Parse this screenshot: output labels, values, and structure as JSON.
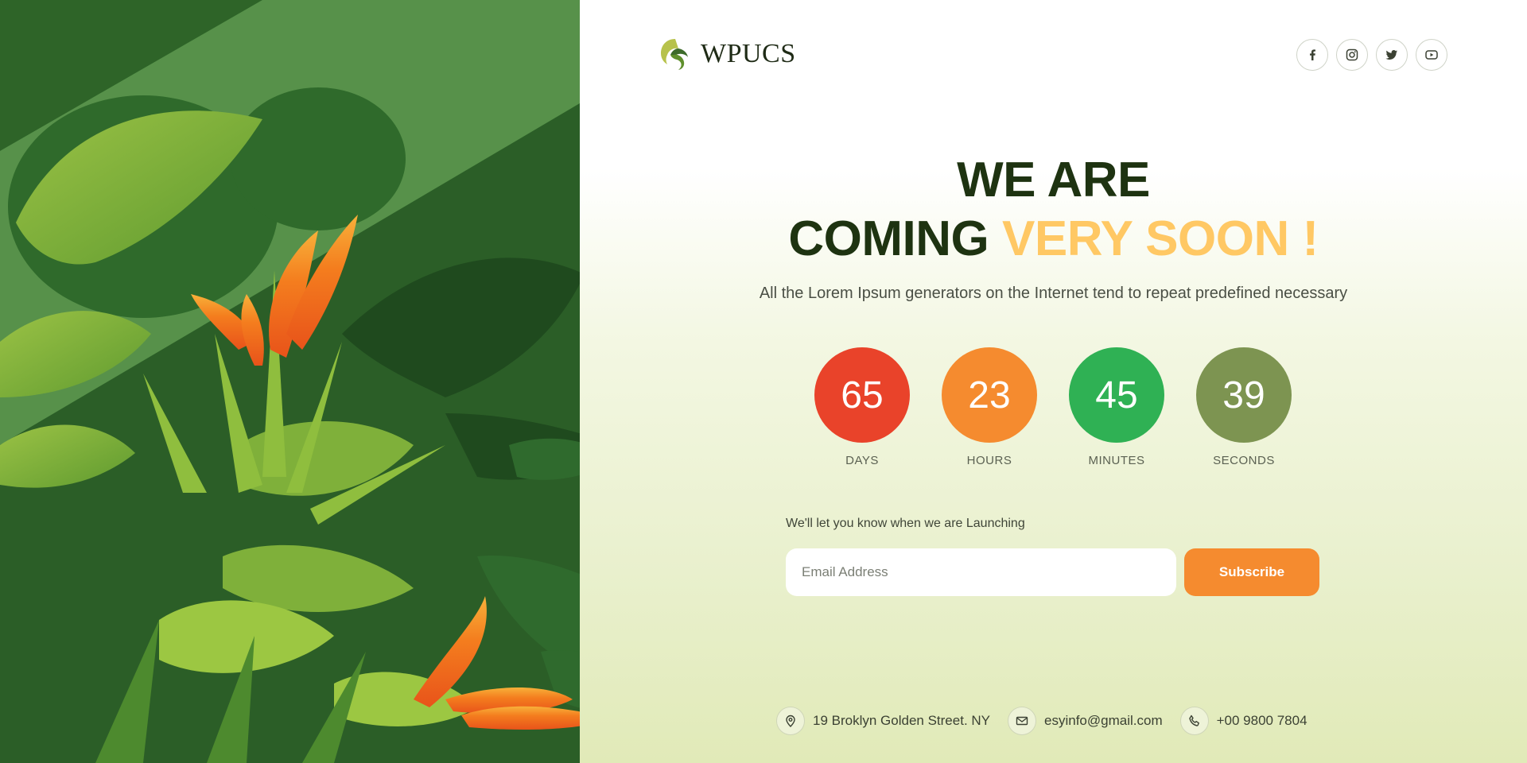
{
  "brand": {
    "name": "WPUCS"
  },
  "social": [
    {
      "icon": "facebook-icon"
    },
    {
      "icon": "instagram-icon"
    },
    {
      "icon": "twitter-icon"
    },
    {
      "icon": "youtube-icon"
    }
  ],
  "hero": {
    "line1": "WE ARE",
    "line2_main": "COMING ",
    "line2_accent": "VERY SOON !",
    "subtitle": "All the Lorem Ipsum generators on the Internet tend to repeat predefined necessary"
  },
  "countdown": [
    {
      "value": "65",
      "label": "DAYS",
      "color": "#e9432a"
    },
    {
      "value": "23",
      "label": "HOURS",
      "color": "#f58b2f"
    },
    {
      "value": "45",
      "label": "MINUTES",
      "color": "#2fb154"
    },
    {
      "value": "39",
      "label": "SECONDS",
      "color": "#7d9451"
    }
  ],
  "subscribe": {
    "notice": "We'll let you know when we are Launching",
    "placeholder": "Email Address",
    "button": "Subscribe"
  },
  "contacts": [
    {
      "icon": "location-pin-icon",
      "text": "19 Broklyn Golden Street. NY"
    },
    {
      "icon": "mail-icon",
      "text": "esyinfo@gmail.com"
    },
    {
      "icon": "phone-icon",
      "text": "+00 9800 7804"
    }
  ],
  "colors": {
    "heading": "#1e3311",
    "accent": "#ffc864",
    "primary_button": "#f58b2f"
  }
}
